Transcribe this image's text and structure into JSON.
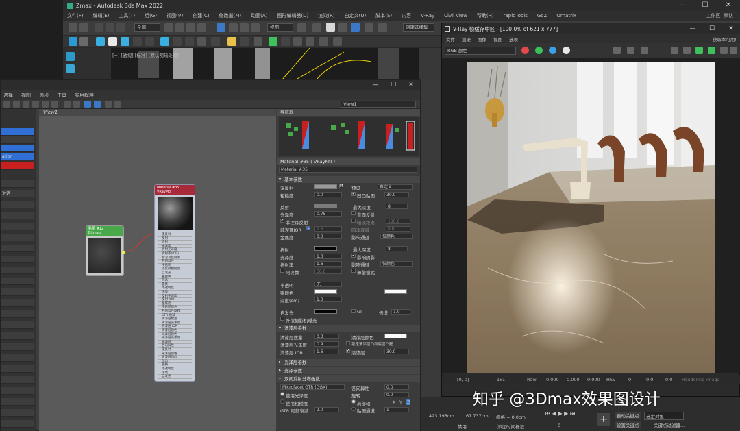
{
  "max": {
    "title": "Zmax - Autodesk 3ds Max 2022",
    "menu": [
      "文件(F)",
      "编辑(E)",
      "工具(T)",
      "组(G)",
      "视图(V)",
      "创建(C)",
      "修改器(M)",
      "动画(A)",
      "图形编辑器(D)",
      "渲染(R)",
      "自定义(U)",
      "脚本(S)",
      "内容",
      "V-Ray",
      "Civil View",
      "帮助(H)",
      "rapidTools",
      "GoZ",
      "Ornatrix"
    ],
    "workspace": "工作区: 默认",
    "toolbar": {
      "selection_filter": "全部",
      "view_dropdown": "视图",
      "named_set": "创建选择集"
    },
    "viewport_label": "[+] [透视] [标准] [默认明暗处理]"
  },
  "slate": {
    "menu": [
      "选择",
      "视图",
      "选项",
      "工具",
      "实用程序"
    ],
    "view_tab": "View1",
    "view_dropdown": "View1",
    "left_items": [
      "",
      "",
      "ation",
      "",
      "",
      "对话"
    ],
    "nodes": {
      "bitmap": {
        "title": "贴图 #12",
        "subtitle": "Bitmap"
      },
      "material": {
        "title": "Material #35",
        "subtitle": "VRayMtl",
        "slots": [
          "漫反射",
          "反射",
          "折射",
          "光泽度",
          "折射光泽度",
          "折射率(IOR)",
          "菲涅耳反射率",
          "各向异性",
          "半透明",
          "漫反射粗糙度",
          "自发光",
          "雾颜色",
          "凹凸",
          "置换",
          "不透明度",
          "环境",
          "反射光泽度",
          "反射 IOR",
          "金属度",
          "半透明颜色",
          "各向异性旋转",
          "GTR 衰减",
          "清漆层数量",
          "清漆层光泽度",
          "清漆层 IOR",
          "清漆层颜色",
          "光泽层颜色",
          "光泽层光泽度",
          "光泽层",
          "各向异性",
          "漫反射",
          "光泽层颜色",
          "清漆层凹凸",
          "凹凸",
          "置换",
          "不透明度",
          "环境",
          "自发光"
        ]
      }
    },
    "navigator_title": "导航器",
    "material_header": "Material #35 ( VRayMtl )",
    "material_name": "Material #35",
    "sections": {
      "basic": "基本参数",
      "coat": "清漆层参数",
      "sheen": "光泽层参数",
      "sss": "光泽参数",
      "brdf": "双向反射分布函数"
    },
    "params": {
      "diffuse": "漫反射",
      "roughness": "粗糙度",
      "roughness_val": "0.0",
      "preset": "预设",
      "preset_val": "自定义",
      "bump_map": "凹凸贴图",
      "bump_val": "30.0",
      "reflect": "反射",
      "max_depth": "最大深度",
      "max_depth_val": "8",
      "gloss": "光泽度",
      "gloss_val": "0.75",
      "backside_reflect": "背面反射",
      "fresnel": "菲涅耳反射",
      "dim_distance": "暗淡距离",
      "dim_val": "100.0",
      "fresnel_ior": "菲涅耳IOR",
      "fresnel_ior_val": "1.6",
      "dim_falloff": "暗淡衰减",
      "dim_falloff_val": "0.0",
      "metalness": "金属度",
      "metalness_val": "0.0",
      "affect_channels": "影响通道",
      "affect_channels_val": "仅颜色",
      "refract": "折射",
      "r_max_depth": "最大深度",
      "r_max_depth_val": "8",
      "r_gloss": "光泽度",
      "r_gloss_val": "1.0",
      "affect_shadows": "影响阴影",
      "ior": "折射率",
      "ior_val": "1.6",
      "r_affect_channels": "影响通道",
      "r_affect_channels_val": "仅颜色",
      "abbe": "阿贝数",
      "abbe_val": "50.0",
      "thin_walled": "薄壁模式",
      "translucency": "半透明",
      "translucency_val": "无",
      "scatter_color": "雾颜色",
      "depth": "深度(cm)",
      "depth_val": "1.0",
      "self_illum": "自发光",
      "gi": "GI",
      "multiplier": "倍增",
      "multiplier_val": "1.0",
      "compensate": "补偿摄影机曝光",
      "coat_amount": "清漆层数量",
      "coat_amount_val": "0.3",
      "coat_color": "清漆层颜色",
      "coat_gloss": "清漆层光泽度",
      "coat_gloss_val": "0.9",
      "coat_lock": "锁定清漆层凸到底层凸起",
      "coat_ior": "清漆层 IOR",
      "coat_ior_val": "1.6",
      "coat_layer": "清漆层",
      "coat_layer_val": "30.0",
      "brdf_type": "Microfacet GTR (GGX)",
      "aniso": "各向异性",
      "aniso_val": "0.0",
      "use_gloss": "使用光泽度",
      "rotation": "旋转",
      "rotation_val": "0.0",
      "use_roughness": "使用粗糙度",
      "local_axis": "局部轴",
      "axis_x": "X",
      "axis_y": "Y",
      "axis_z": "Z",
      "gtr_tail": "GTR 尾部衰减",
      "gtr_tail_val": "2.0",
      "map_channel": "贴图通道",
      "map_channel_val": "1"
    }
  },
  "vfb": {
    "title": "V-Ray 帧缓存中区 - [100.0% of 621 x 777]",
    "menu": [
      "文件",
      "渲染",
      "图像",
      "视图",
      "选项"
    ],
    "help": "获取本可用!",
    "channel": "RGB 颜色",
    "status_left": "[0, 0]",
    "status_items": [
      "1x1",
      "Raw",
      "0.000",
      "0.000",
      "0.000",
      "HSV",
      "0",
      "0.0",
      "0.0"
    ],
    "status_right": "Rendering image"
  },
  "bottom": {
    "coords": "423.195cm",
    "coord2": "67.737cm",
    "grid": "栅格 = 0.0cm",
    "frame": "0",
    "auto_key": "自动关键点",
    "selected": "选定对象",
    "set_key": "设置关键点",
    "key_filter": "关键点过滤器...",
    "add_time_tag": "添加时间标记",
    "disable": "禁用"
  },
  "watermark": "知乎 @3Dmax效果图设计",
  "colors": {
    "accent_blue": "#2f6fd6",
    "accent_red": "#c8201e",
    "node_green": "#49a84a",
    "node_red": "#a8293a"
  }
}
